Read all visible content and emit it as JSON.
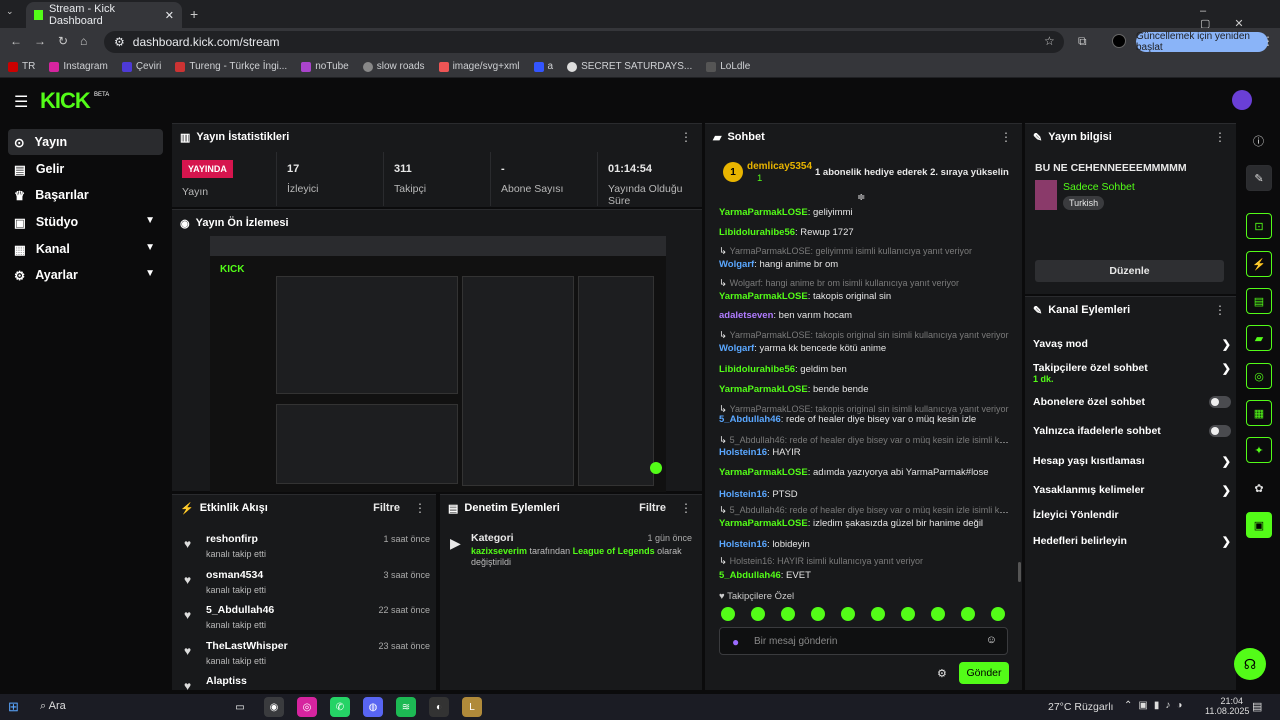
{
  "browser": {
    "tab_title": "Stream - Kick Dashboard",
    "url": "dashboard.kick.com/stream",
    "update_button": "Güncellemek için yeniden başlat",
    "bookmarks": [
      "TR",
      "Instagram",
      "Çeviri",
      "Tureng - Türkçe İngi...",
      "noTube",
      "slow roads",
      "image/svg+xml",
      "a",
      "SECRET SATURDAYS...",
      "LoLdle"
    ]
  },
  "kick": {
    "logo": "KICK",
    "beta": "BETA",
    "nav": [
      {
        "label": "Yayın",
        "icon": "broadcast-icon"
      },
      {
        "label": "Gelir",
        "icon": "revenue-icon"
      },
      {
        "label": "Başarılar",
        "icon": "trophy-icon"
      },
      {
        "label": "Stüdyo",
        "icon": "studio-icon"
      },
      {
        "label": "Kanal",
        "icon": "channel-icon"
      },
      {
        "label": "Ayarlar",
        "icon": "settings-icon"
      }
    ]
  },
  "stats": {
    "title": "Yayın İstatistikleri",
    "live_badge": "YAYINDA",
    "items": [
      {
        "value": "",
        "label": "Yayın"
      },
      {
        "value": "17",
        "label": "İzleyici"
      },
      {
        "value": "311",
        "label": "Takipçi"
      },
      {
        "value": "-",
        "label": "Abone Sayısı"
      },
      {
        "value": "01:14:54",
        "label": "Yayında Olduğu Süre"
      }
    ]
  },
  "preview": {
    "title": "Yayın Ön İzlemesi"
  },
  "activity": {
    "title": "Etkinlik Akışı",
    "filter": "Filtre",
    "events": [
      {
        "name": "reshonfirp",
        "sub": "kanalı takip etti",
        "time": "1 saat önce"
      },
      {
        "name": "osman4534",
        "sub": "kanalı takip etti",
        "time": "3 saat önce"
      },
      {
        "name": "5_Abdullah46",
        "sub": "kanalı takip etti",
        "time": "22 saat önce"
      },
      {
        "name": "TheLastWhisper",
        "sub": "kanalı takip etti",
        "time": "23 saat önce"
      },
      {
        "name": "Alaptiss",
        "sub": "",
        "time": "23 saat önce"
      }
    ]
  },
  "moderation": {
    "title": "Denetim Eylemleri",
    "filter": "Filtre",
    "item_title": "Kategori",
    "item_time": "1 gün önce",
    "item_user": "kazixseverim",
    "item_mid": " tarafından ",
    "item_game": "League of Legends",
    "item_end": " olarak",
    "item_line2": "değiştirildi"
  },
  "chat": {
    "title": "Sohbet",
    "pinned_user": "demlicay5354",
    "pinned_count": "1",
    "pinned_msg": "1 abonelik hediye ederek 2. sıraya yükselin",
    "lines": [
      {
        "user": "YarmaParmakLOSE",
        "msg": ": geliyimmi",
        "color": "g"
      },
      {
        "user": "Libidolurahibe56",
        "msg": ": Rewup 1727",
        "color": "g"
      },
      {
        "reply": "YarmaParmakLOSE: geliyimmi isimli kullanıcıya yanıt veriyor"
      },
      {
        "user": "Wolgarf",
        "msg": ": hangi anime br om",
        "color": "b"
      },
      {
        "reply": "Wolgarf: hangi anime br om isimli kullanıcıya yanıt veriyor"
      },
      {
        "user": "YarmaParmakLOSE",
        "msg": ": takopis original sin",
        "color": "g"
      },
      {
        "user": "adaletseven",
        "msg": ": ben varım hocam",
        "color": "p"
      },
      {
        "reply": "YarmaParmakLOSE: takopis original sin isimli kullanıcıya yanıt veriyor"
      },
      {
        "user": "Wolgarf",
        "msg": ": yarma kk bencede kötü anime",
        "color": "b"
      },
      {
        "user": "Libidolurahibe56",
        "msg": ": geldim ben",
        "color": "g"
      },
      {
        "user": "YarmaParmakLOSE",
        "msg": ": bende bende",
        "color": "g"
      },
      {
        "reply": "YarmaParmakLOSE: takopis original sin isimli kullanıcıya yanıt veriyor"
      },
      {
        "user": "5_Abdullah46",
        "msg": ": rede of healer diye bisey var o müq kesin izle",
        "color": "b"
      },
      {
        "reply": "5_Abdullah46: rede of healer diye bisey var o müq kesin izle isimli kull..."
      },
      {
        "user": "Holstein16",
        "msg": ": HAYIR",
        "color": "b"
      },
      {
        "user": "YarmaParmakLOSE",
        "msg": ": adımda yazıyorya abi YarmaParmak#lose",
        "color": "g"
      },
      {
        "user": "Holstein16",
        "msg": ": PTSD",
        "color": "b"
      },
      {
        "reply": "5_Abdullah46: rede of healer diye bisey var o müq kesin izle isimli kull..."
      },
      {
        "user": "YarmaParmakLOSE",
        "msg": ": izledim şakasızda güzel bir hanime değil",
        "color": "g"
      },
      {
        "user": "Holstein16",
        "msg": ": lobideyin",
        "color": "b"
      },
      {
        "reply": "Holstein16: HAYIR isimli kullanıcıya yanıt veriyor"
      },
      {
        "user": "5_Abdullah46",
        "msg": ": EVET",
        "color": "g"
      }
    ],
    "followers_only": "Takipçilere Özel",
    "input_placeholder": "Bir mesaj gönderin",
    "send": "Gönder"
  },
  "stream_info": {
    "title": "Yayın bilgisi",
    "stream_title": "BU NE CEHENNEEEEMMMMM",
    "category": "Sadece Sohbet",
    "tag": "Turkish",
    "edit": "Düzenle"
  },
  "channel_actions": {
    "title": "Kanal Eylemleri",
    "items": [
      {
        "label": "Yavaş mod",
        "kind": "arrow"
      },
      {
        "label": "Takipçilere özel sohbet",
        "sub": "1 dk.",
        "kind": "arrow"
      },
      {
        "label": "Abonelere özel sohbet",
        "kind": "toggle"
      },
      {
        "label": "Yalnızca ifadelerle sohbet",
        "kind": "toggle"
      },
      {
        "label": "Hesap yaşı kısıtlaması",
        "kind": "arrow"
      },
      {
        "label": "Yasaklanmış kelimeler",
        "kind": "arrow"
      },
      {
        "label": "İzleyici Yönlendir",
        "kind": "none"
      },
      {
        "label": "Hedefleri belirleyin",
        "kind": "arrow"
      }
    ]
  },
  "taskbar": {
    "search": "Ara",
    "weather": "27°C Rüzgarlı",
    "time": "21:04",
    "date": "11.08.2025"
  },
  "colors": {
    "accent": "#53fc18",
    "live": "#d6154e",
    "panel": "#18191b"
  }
}
